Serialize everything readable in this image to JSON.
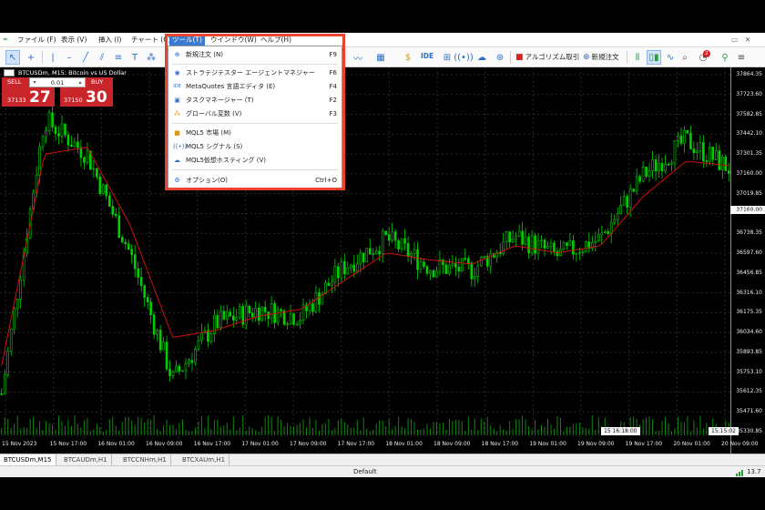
{
  "menubar": {
    "items": [
      {
        "label": "ファイル (F)"
      },
      {
        "label": "表示 (V)"
      },
      {
        "label": "挿入 (I)"
      },
      {
        "label": "チャート (C)"
      },
      {
        "label": "ツール(T)"
      },
      {
        "label": "ウインドウ(W)"
      },
      {
        "label": "ヘルプ(H)"
      }
    ]
  },
  "toolbar": {
    "ide_label": "IDE",
    "algo_label": "アルゴリズム取引",
    "new_order_label": "新規注文"
  },
  "chart": {
    "title": "BTCUSDm, M15: Bitcoin vs US Dollar",
    "sell_label": "SELL",
    "buy_label": "BUY",
    "lot": "0.01",
    "sell_small": "37133",
    "sell_big": "27",
    "buy_small": "37150",
    "buy_big": "30",
    "current_price": "37160.00",
    "time_cursor": "15 16:18:00",
    "time_cursor2": "15:15:02",
    "colors": {
      "candle": "#00d000",
      "ma": "#d01010",
      "grid": "#2a2a2a"
    }
  },
  "chart_data": {
    "type": "line",
    "title": "BTCUSDm, M15: Bitcoin vs US Dollar",
    "y_ticks": [
      "37864.35",
      "37723.60",
      "37582.85",
      "37442.10",
      "37301.35",
      "37160.00",
      "37019.85",
      "36879.10",
      "36738.35",
      "36597.60",
      "36456.85",
      "36316.10",
      "36175.35",
      "36034.60",
      "35893.85",
      "35753.10",
      "35612.35",
      "35471.60",
      "35330.85"
    ],
    "x_ticks": [
      "15 Nov 2023",
      "15 Nov 17:00",
      "16 Nov 01:00",
      "16 Nov 09:00",
      "16 Nov 17:00",
      "17 Nov 01:00",
      "17 Nov 09:00",
      "17 Nov 17:00",
      "18 Nov 01:00",
      "18 Nov 09:00",
      "18 Nov 17:00",
      "19 Nov 01:00",
      "19 Nov 09:00",
      "19 Nov 17:00",
      "20 Nov 01:00",
      "20 Nov 09:00"
    ],
    "ylim": [
      35330.85,
      37864.35
    ],
    "x": [
      "15 Nov 2023",
      "15 Nov 17:00",
      "16 Nov 01:00",
      "16 Nov 09:00",
      "16 Nov 17:00",
      "17 Nov 01:00",
      "17 Nov 09:00",
      "17 Nov 17:00",
      "18 Nov 01:00",
      "18 Nov 09:00",
      "18 Nov 17:00",
      "19 Nov 01:00",
      "19 Nov 09:00",
      "19 Nov 17:00",
      "20 Nov 01:00",
      "20 Nov 09:00"
    ],
    "series": [
      {
        "values": [
          35600,
          37550,
          37300,
          36600,
          35700,
          36100,
          36200,
          36150,
          36500,
          36700,
          36500,
          36480,
          36720,
          36580,
          36700,
          37150,
          37400,
          37200
        ]
      },
      {
        "values": [
          35800,
          37300,
          37350,
          36800,
          36000,
          36050,
          36150,
          36200,
          36400,
          36600,
          36550,
          36520,
          36650,
          36600,
          36650,
          37000,
          37250,
          37220
        ]
      }
    ]
  },
  "tabs": [
    {
      "label": "BTCUSDm,M15"
    },
    {
      "label": "BTCAUDm,H1"
    },
    {
      "label": "BTCCNHm,H1"
    },
    {
      "label": "BTCXAUm,H1"
    }
  ],
  "status": {
    "profile": "Default",
    "right": "13.7"
  },
  "dropdown": {
    "items": [
      {
        "label": "新規注文 (N)",
        "shortcut": "F9",
        "icon": "plus-icon"
      },
      {
        "label": "ストラテジテスター エージェントマネジャー",
        "shortcut": "F6",
        "icon": "globe-icon"
      },
      {
        "label": "MetaQuotes 言語エディタ (E)",
        "shortcut": "F4",
        "icon": "ide-icon"
      },
      {
        "label": "タスクマネージャー (T)",
        "shortcut": "F2",
        "icon": "task-icon"
      },
      {
        "label": "グローバル変数 (V)",
        "shortcut": "F3",
        "icon": "variables-icon"
      },
      {
        "label": "MQL5 市場 (M)",
        "shortcut": "",
        "icon": "bag-icon"
      },
      {
        "label": "MQL5 シグナル (S)",
        "shortcut": "",
        "icon": "signal-icon"
      },
      {
        "label": "MQL5仮想ホスティング (V)",
        "shortcut": "",
        "icon": "cloud-icon"
      },
      {
        "label": "オプション(O)",
        "shortcut": "Ctrl+O",
        "icon": "gear-icon"
      }
    ]
  }
}
